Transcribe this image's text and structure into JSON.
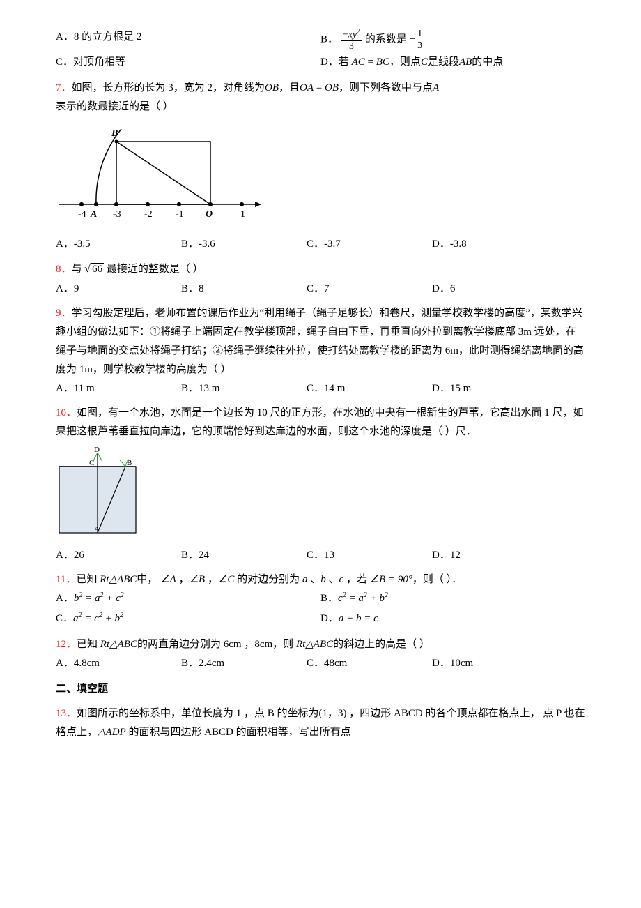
{
  "q6": {
    "A": "8 的立方根是 2",
    "B_pre": "的系数是",
    "C": "对顶角相等",
    "D_pre": "若",
    "D_mid": "，则点",
    "D_post": "是线段",
    "D_end": "的中点"
  },
  "q7": {
    "text": "如图，长方形的长为 3，宽为 2，对角线为",
    "text2": "，且",
    "text3": "，则下列各数中与点",
    "text4": "表示的数最接近的是（   ）",
    "A": "-3.5",
    "B": "-3.6",
    "C": "-3.7",
    "D": "-3.8"
  },
  "q8": {
    "pre": "与",
    "post": "最接近的整数是（   ）",
    "rad": "66",
    "A": "9",
    "B": "8",
    "C": "7",
    "D": "6"
  },
  "q9": {
    "text": "学习勾股定理后，老师布置的课后作业为“利用绳子（绳子足够长）和卷尺，测量学校教学楼的高度”，某数学兴趣小组的做法如下：①将绳子上端固定在教学楼顶部，绳子自由下垂，再垂直向外拉到离教学楼底部 3m 远处，在绳子与地面的交点处将绳子打结；②将绳子继续往外拉，使打结处离教学楼的距离为 6m，此时测得绳结离地面的高度为 1m，则学校教学楼的高度为（      ）",
    "A": "11 m",
    "B": "13 m",
    "C": "14 m",
    "D": "15 m"
  },
  "q10": {
    "text": "如图，有一个水池，水面是一个边长为 10 尺的正方形，在水池的中央有一根新生的芦苇，它高出水面 1 尺，如果把这根芦苇垂直拉向岸边，它的顶端恰好到达岸边的水面，则这个水池的深度是（        ）尺．",
    "A": "26",
    "B": "24",
    "C": "13",
    "D": "12"
  },
  "q11": {
    "pre": "已知",
    "mid": "中，",
    "mid2": "的对边分别为",
    "mid3": "，若",
    "post": "，则（   ）．"
  },
  "q12": {
    "pre": "已知",
    "mid": "的两直角边分别为",
    "mid2": "，则",
    "post": "的斜边上的高是（   ）",
    "A": "4.8cm",
    "B": "2.4cm",
    "C": "48cm",
    "D": "10cm"
  },
  "fill_header": "二、填空题",
  "q13": {
    "text": "如图所示的坐标系中，单位长度为 1 ，点 B 的坐标为(1，3) ，四边形 ABCD 的各个顶点都在格点上， 点 P 也在格点上，",
    "text2": " 的面积与四边形 ABCD 的面积相等，写出所有点"
  },
  "labels": {
    "A": "A．",
    "B": "B．",
    "C": "C．",
    "D": "D．",
    "n7": "7．",
    "n8": "8．",
    "n9": "9．",
    "n10": "10．",
    "n11": "11．",
    "n12": "12．",
    "n13": "13．",
    "OB": "OB",
    "OA": "OA",
    "AC": "AC",
    "BC": "BC",
    "Cpt": "C",
    "Apt": "A",
    "AB": "AB",
    "angA": "∠A",
    "angB": "∠B",
    "angC": "∠C",
    "la": "a",
    "lb": "b",
    "lc": "c",
    "B90": "∠B = 90°",
    "rt": "Rt△ABC",
    "six": "6cm",
    "eight": "8cm",
    "adp": "△ADP",
    "eqA": "b² = a² + c²",
    "eqB": "c² = a² + b²",
    "eqC": "a² = c² + b²",
    "eqD": "a + b = c"
  }
}
